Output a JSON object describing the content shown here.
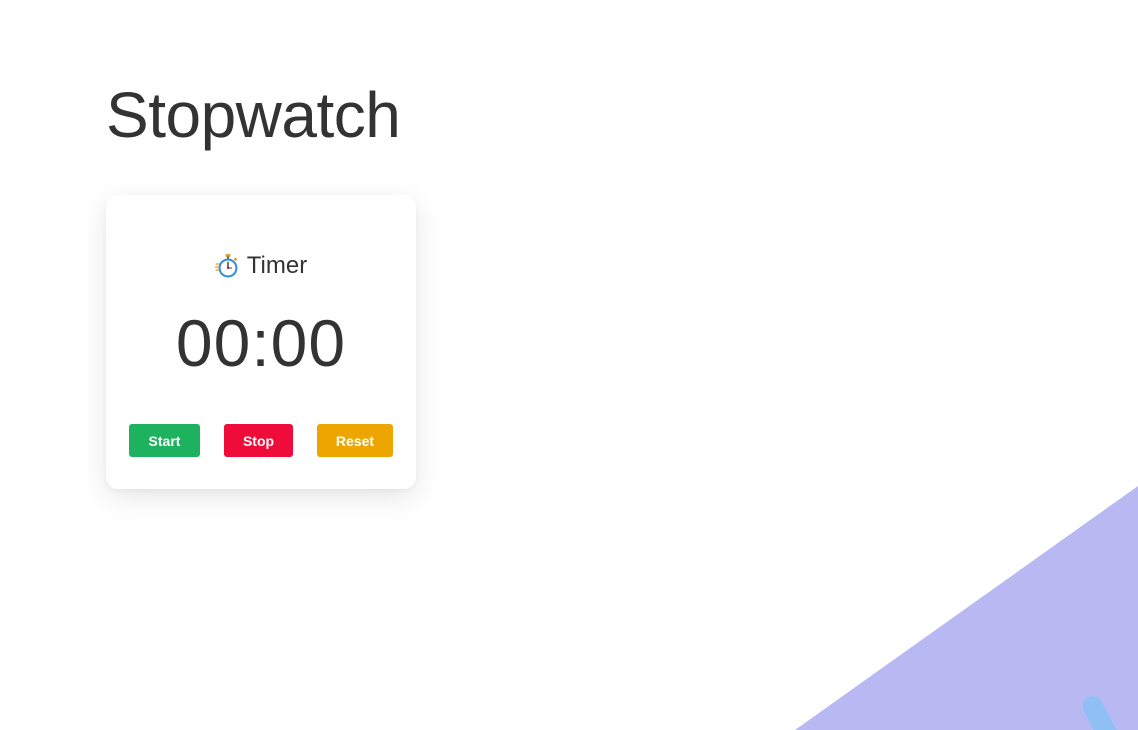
{
  "page": {
    "title": "Stopwatch"
  },
  "timer": {
    "icon": "stopwatch-icon",
    "label": "Timer",
    "display": "00:00"
  },
  "controls": {
    "start_label": "Start",
    "stop_label": "Stop",
    "reset_label": "Reset"
  },
  "colors": {
    "start": "#1db35e",
    "stop": "#ef0c3a",
    "reset": "#eda600",
    "decor_purple": "#b8b8f2",
    "decor_blue": "#8ec0f5"
  }
}
